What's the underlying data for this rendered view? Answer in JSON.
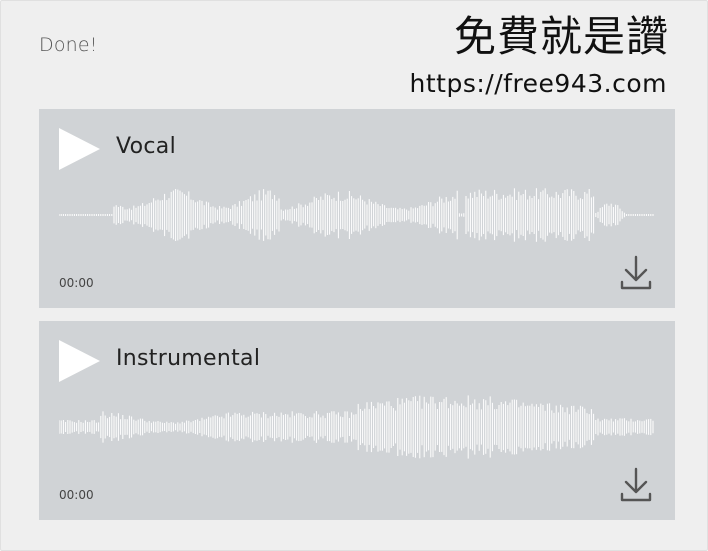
{
  "header": {
    "status": "Done!",
    "brand": "免費就是讚",
    "url": "https://free943.com"
  },
  "tracks": [
    {
      "title": "Vocal",
      "time": "00:00"
    },
    {
      "title": "Instrumental",
      "time": "00:00"
    }
  ],
  "colors": {
    "panel": "#efefef",
    "card": "#d0d3d6",
    "wave": "#ffffff",
    "icon": "#555555"
  }
}
